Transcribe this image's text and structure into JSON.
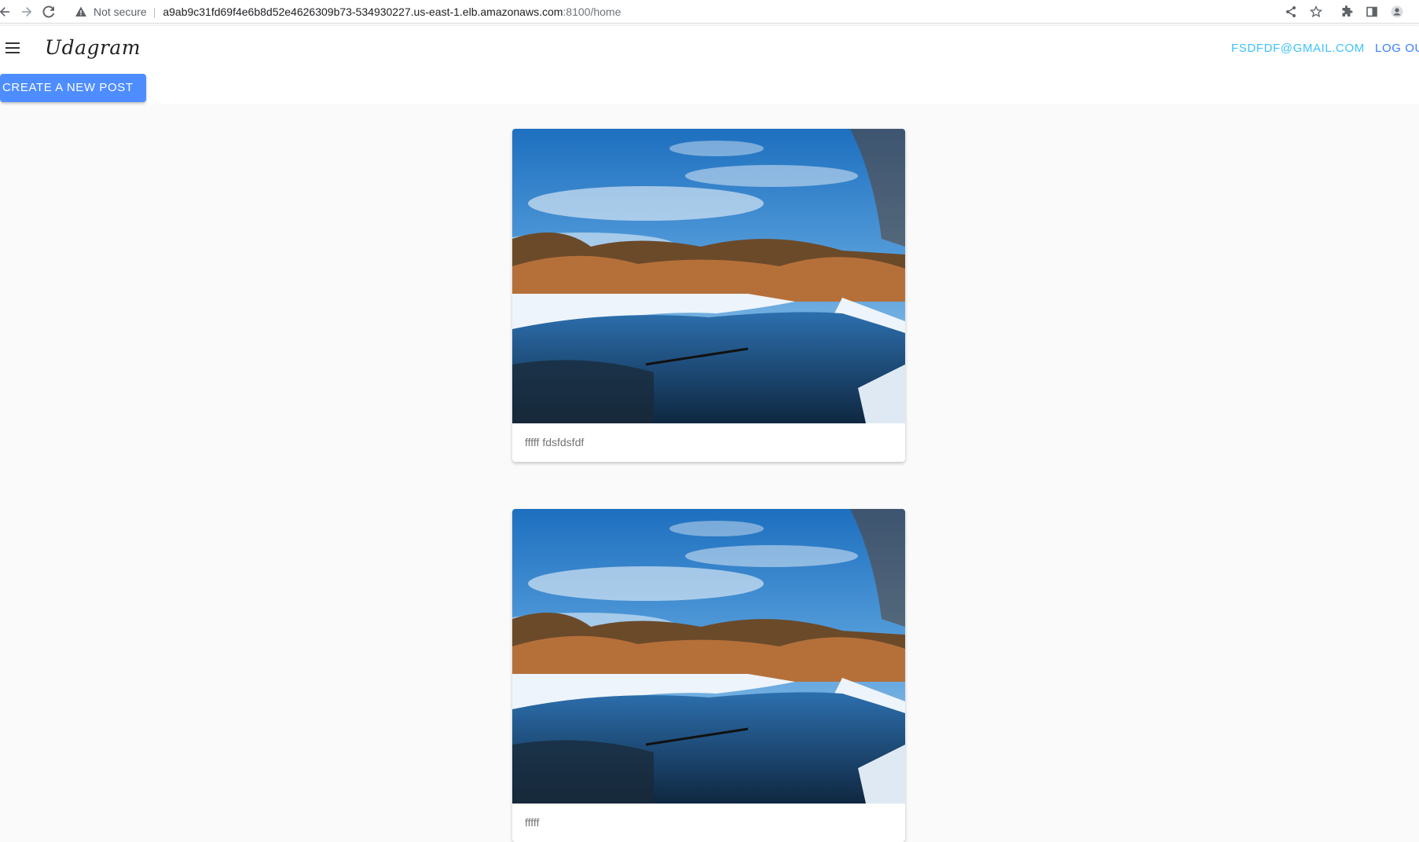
{
  "browser": {
    "security_label": "Not secure",
    "url_host": "a9ab9c31fd69f4e6b8d52e4626309b73-534930227.us-east-1.elb.amazonaws.com",
    "url_path": ":8100/home"
  },
  "toolbar": {
    "brand": "Udagram",
    "user_email": "FSDFDF@GMAIL.COM",
    "logout_label": "LOG OU"
  },
  "actions": {
    "create_label": "CREATE A NEW POST"
  },
  "feed": {
    "posts": [
      {
        "caption": "fffff fdsfdsfdf"
      },
      {
        "caption": "fffff"
      }
    ]
  },
  "colors": {
    "primary": "#3880ff",
    "secondary": "#3dc2ff",
    "button": "#4d8dff",
    "background": "#fafafa"
  },
  "icons": {
    "browser": [
      "back-icon",
      "forward-icon",
      "reload-icon",
      "warning-icon",
      "share-icon",
      "star-icon",
      "extension-icon",
      "sidepanel-icon",
      "profile-icon"
    ],
    "app": [
      "menu-icon"
    ]
  }
}
